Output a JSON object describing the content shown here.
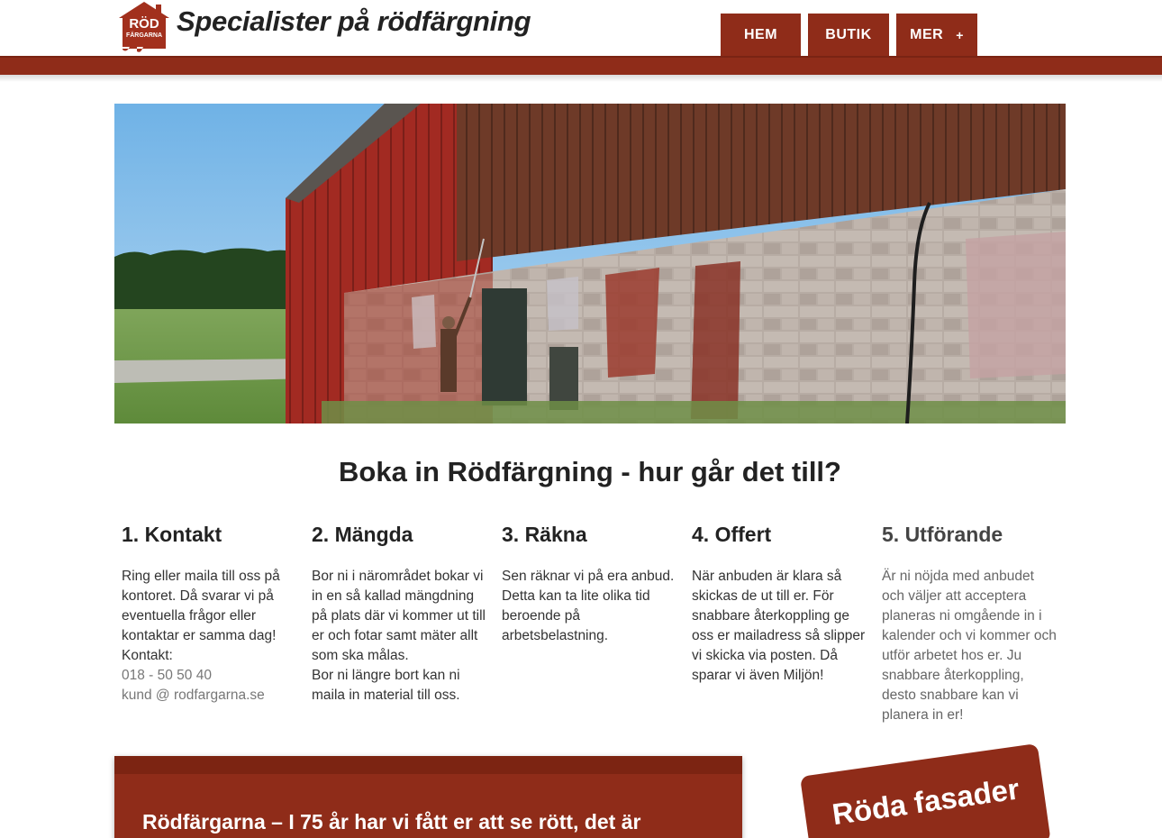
{
  "header": {
    "logo_line1": "RÖD",
    "logo_line2": "FÄRGARNA",
    "site_title": "Specialister på rödfärgning"
  },
  "nav": {
    "items": [
      {
        "label": "HEM"
      },
      {
        "label": "BUTIK"
      },
      {
        "label": "MER"
      }
    ],
    "expand_icon": "+"
  },
  "hero": {
    "icon": "barn-photo",
    "alt": ""
  },
  "section": {
    "title": "Boka in Rödfärgning - hur går det till?"
  },
  "steps": [
    {
      "title": "1. Kontakt",
      "lines": [
        "Ring eller maila till oss på kontoret. Då svarar vi på eventuella frågor eller kontaktar er samma dag!",
        "Kontakt:"
      ],
      "phone": "018 - 50 50 40",
      "email": "kund @ rodfargarna.se"
    },
    {
      "title": "2. Mängda",
      "lines": [
        "Bor ni i närområdet bokar vi in en så kallad mängdning på plats där vi kommer ut till er och fotar samt mäter allt som ska målas.",
        "Bor ni längre bort kan ni maila in material till oss."
      ]
    },
    {
      "title": "3. Räkna",
      "lines": [
        "Sen räknar vi på era anbud. Detta kan ta lite olika tid beroende på arbetsbelastning."
      ]
    },
    {
      "title": "4. Offert",
      "lines": [
        "När anbuden är klara så skickas de ut till er. För snabbare återkoppling ge oss er mailadress så slipper vi skicka via posten. Då sparar vi även Miljön!"
      ]
    },
    {
      "title": "5. Utförande",
      "lines": [
        "Är ni nöjda med anbudet och väljer att acceptera planeras ni omgående in i kalender och vi kommer och utför arbetet hos er. Ju snabbare återkoppling, desto snabbare kan vi planera in er!"
      ]
    }
  ],
  "panel": {
    "text": "Rödfärgarna – I 75 år har vi fått er att se rött, det är"
  },
  "badge": {
    "text": "Röda fasader"
  },
  "colors": {
    "brand": "#8f2c19",
    "brand_dark": "#7c2412"
  }
}
